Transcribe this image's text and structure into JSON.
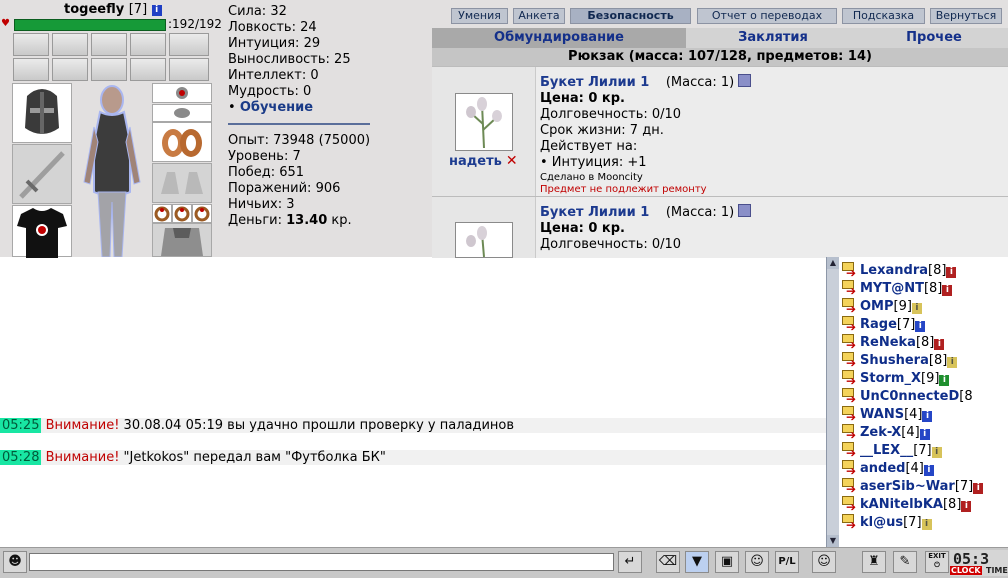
{
  "hero": {
    "name": "togeefly",
    "level": "[7]",
    "hp": ":192/192"
  },
  "stats": {
    "strength": "Сила: 32",
    "agility": "Ловкость: 24",
    "intuition": "Интуиция: 29",
    "endurance": "Выносливость: 25",
    "intellect": "Интеллект: 0",
    "wisdom": "Мудрость: 0",
    "training": "Обучение"
  },
  "progress": {
    "experience": "Опыт: 73948 (75000)",
    "level": "Уровень: 7",
    "wins": "Побед: 651",
    "losses": "Поражений: 906",
    "draws": "Ничьих: 3",
    "money_label": "Деньги:",
    "money_value": "13.40",
    "money_unit": "кр."
  },
  "top_buttons": [
    "Умения",
    "Анкета",
    "Безопасность",
    "Отчет о переводах",
    "Подсказка",
    "Вернуться"
  ],
  "inventory": {
    "tabs": [
      "Обмундирование",
      "Заклятия",
      "Прочее"
    ],
    "backpack_title": "Рюкзак (масса: 107/128, предметов: 14)",
    "wear_label": "надеть",
    "items": [
      {
        "name": "Букет Лилии 1",
        "mass": "(Масса: 1)",
        "price": "Цена: 0 кр.",
        "durability": "Долговечность: 0/10",
        "lifetime": "Срок жизни: 7 дн.",
        "effects_label": "Действует на:",
        "effect": "• Интуиция: +1",
        "made_in": "Сделано в Mooncity",
        "no_repair": "Предмет не подлежит ремонту"
      },
      {
        "name": "Букет Лилии 1",
        "mass": "(Масса: 1)",
        "price": "Цена: 0 кр.",
        "durability": "Долговечность: 0/10"
      }
    ]
  },
  "chat": {
    "messages": [
      {
        "time": "05:25",
        "label": "Внимание!",
        "text": " 30.08.04 05:19 вы удачно прошли проверку у паладинов"
      },
      {
        "time": "05:28",
        "label": "Внимание!",
        "text": " \"Jetkokos\" передал вам \"Футболка БК\""
      }
    ],
    "input_value": ""
  },
  "online_users": [
    {
      "name": "Lexandra",
      "level": "[8]",
      "badge": "red"
    },
    {
      "name": "MYT@NT",
      "level": "[8]",
      "badge": "red"
    },
    {
      "name": "ОМР",
      "level": "[9]",
      "badge": "yellow"
    },
    {
      "name": "Rage",
      "level": "[7]",
      "badge": "blue"
    },
    {
      "name": "ReNeka",
      "level": "[8]",
      "badge": "red"
    },
    {
      "name": "Shushera",
      "level": "[8]",
      "badge": "yellow"
    },
    {
      "name": "Storm_X",
      "level": "[9]",
      "badge": "green"
    },
    {
      "name": "UnC0nnecteD",
      "level": "[8",
      "badge": ""
    },
    {
      "name": "WANS",
      "level": "[4]",
      "badge": "blue"
    },
    {
      "name": "Zek-X",
      "level": "[4]",
      "badge": "blue"
    },
    {
      "name": "__LEX__",
      "level": "[7]",
      "badge": "yellow"
    },
    {
      "name": "anded",
      "level": "[4]",
      "badge": "blue"
    },
    {
      "name": "aserSib~War",
      "level": "[7]",
      "badge": "red"
    },
    {
      "name": "kANitelbKA",
      "level": "[8]",
      "badge": "red"
    },
    {
      "name": "kl@us",
      "level": "[7]",
      "badge": "yellow"
    }
  ],
  "clock": {
    "time": "05:3",
    "clock_label": "CLOCK",
    "time_label": "TIME",
    "exit_label": "EXIT"
  },
  "colors": {
    "hp_bar": "#169a38",
    "chat_time_bg": "#18e6a3",
    "warning": "#c00000",
    "link": "#1c3a8f"
  }
}
